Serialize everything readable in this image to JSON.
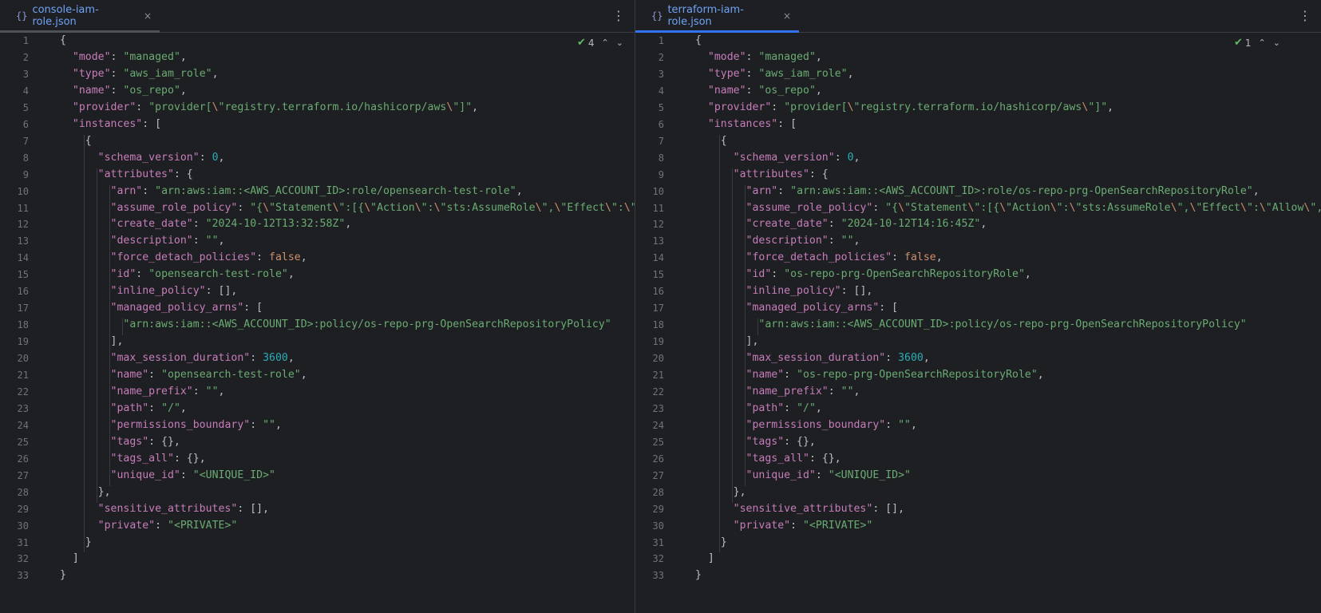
{
  "left": {
    "tab": {
      "icon": "{}",
      "title": "console-iam-role.json",
      "close": "×"
    },
    "menu": "⋮",
    "inspection": {
      "count": "4"
    },
    "lines": [
      "{",
      "  \"mode\": \"managed\",",
      "  \"type\": \"aws_iam_role\",",
      "  \"name\": \"os_repo\",",
      "  \"provider\": \"provider[\\\"registry.terraform.io/hashicorp/aws\\\"]\",",
      "  \"instances\": [",
      "    {",
      "      \"schema_version\": 0,",
      "      \"attributes\": {",
      "        \"arn\": \"arn:aws:iam::<AWS_ACCOUNT_ID>:role/opensearch-test-role\",",
      "        \"assume_role_policy\": \"{\\\"Statement\\\":[{\\\"Action\\\":\\\"sts:AssumeRole\\\",\\\"Effect\\\":\\\"A",
      "        \"create_date\": \"2024-10-12T13:32:58Z\",",
      "        \"description\": \"\",",
      "        \"force_detach_policies\": false,",
      "        \"id\": \"opensearch-test-role\",",
      "        \"inline_policy\": [],",
      "        \"managed_policy_arns\": [",
      "          \"arn:aws:iam::<AWS_ACCOUNT_ID>:policy/os-repo-prg-OpenSearchRepositoryPolicy\"",
      "        ],",
      "        \"max_session_duration\": 3600,",
      "        \"name\": \"opensearch-test-role\",",
      "        \"name_prefix\": \"\",",
      "        \"path\": \"/\",",
      "        \"permissions_boundary\": \"\",",
      "        \"tags\": {},",
      "        \"tags_all\": {},",
      "        \"unique_id\": \"<UNIQUE_ID>\"",
      "      },",
      "      \"sensitive_attributes\": [],",
      "      \"private\": \"<PRIVATE>\"",
      "    }",
      "  ]",
      "}"
    ]
  },
  "right": {
    "tab": {
      "icon": "{}",
      "title": "terraform-iam-role.json",
      "close": "×"
    },
    "menu": "⋮",
    "inspection": {
      "count": "1"
    },
    "lines": [
      "{",
      "  \"mode\": \"managed\",",
      "  \"type\": \"aws_iam_role\",",
      "  \"name\": \"os_repo\",",
      "  \"provider\": \"provider[\\\"registry.terraform.io/hashicorp/aws\\\"]\",",
      "  \"instances\": [",
      "    {",
      "      \"schema_version\": 0,",
      "      \"attributes\": {",
      "        \"arn\": \"arn:aws:iam::<AWS_ACCOUNT_ID>:role/os-repo-prg-OpenSearchRepositoryRole\",",
      "        \"assume_role_policy\": \"{\\\"Statement\\\":[{\\\"Action\\\":\\\"sts:AssumeRole\\\",\\\"Effect\\\":\\\"Allow\\\",\\\"Pr",
      "        \"create_date\": \"2024-10-12T14:16:45Z\",",
      "        \"description\": \"\",",
      "        \"force_detach_policies\": false,",
      "        \"id\": \"os-repo-prg-OpenSearchRepositoryRole\",",
      "        \"inline_policy\": [],",
      "        \"managed_policy_arns\": [",
      "          \"arn:aws:iam::<AWS_ACCOUNT_ID>:policy/os-repo-prg-OpenSearchRepositoryPolicy\"",
      "        ],",
      "        \"max_session_duration\": 3600,",
      "        \"name\": \"os-repo-prg-OpenSearchRepositoryRole\",",
      "        \"name_prefix\": \"\",",
      "        \"path\": \"/\",",
      "        \"permissions_boundary\": \"\",",
      "        \"tags\": {},",
      "        \"tags_all\": {},",
      "        \"unique_id\": \"<UNIQUE_ID>\"",
      "      },",
      "      \"sensitive_attributes\": [],",
      "      \"private\": \"<PRIVATE>\"",
      "    }",
      "  ]",
      "}"
    ]
  },
  "colors": {
    "background": "#1e1f22",
    "key": "#c77dbb",
    "string": "#6aab73",
    "number": "#2aacb8",
    "keyword": "#cf8e6d",
    "active_tab_underline": "#3574f0",
    "inactive_tab_underline": "#4e5157"
  },
  "icons": {
    "tab_icon": "json-file-icon",
    "close": "close-icon",
    "menu": "more-vertical-icon",
    "inspection": "check-icon"
  }
}
